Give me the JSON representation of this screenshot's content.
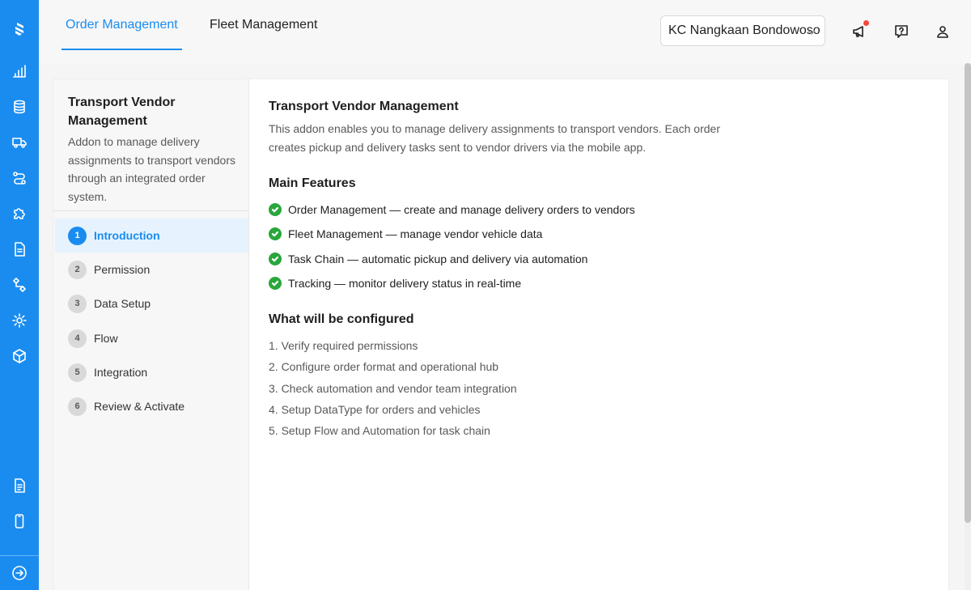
{
  "colors": {
    "brand": "#1a8cf0",
    "success": "#2aa63d",
    "notification": "#f5483b"
  },
  "rail": {
    "icons": [
      "logo-icon",
      "bar-chart-icon",
      "database-icon",
      "truck-icon",
      "route-icon",
      "puzzle-icon",
      "document-icon",
      "flow-icon",
      "gear-icon",
      "box-icon",
      "file-text-icon",
      "mobile-icon",
      "expand-icon"
    ]
  },
  "header": {
    "tabs": [
      {
        "label": "Order Management",
        "active": true
      },
      {
        "label": "Fleet Management",
        "active": false
      }
    ],
    "hub_select": {
      "value": "KC Nangkaan Bondowoso"
    },
    "icons": [
      "megaphone-icon",
      "help-icon",
      "user-icon"
    ]
  },
  "sidebar": {
    "title": "Transport Vendor Management",
    "description": "Addon to manage delivery assignments to transport vendors through an integrated order system.",
    "steps": [
      {
        "num": "1",
        "label": "Introduction",
        "active": true
      },
      {
        "num": "2",
        "label": "Permission",
        "active": false
      },
      {
        "num": "3",
        "label": "Data Setup",
        "active": false
      },
      {
        "num": "4",
        "label": "Flow",
        "active": false
      },
      {
        "num": "5",
        "label": "Integration",
        "active": false
      },
      {
        "num": "6",
        "label": "Review & Activate",
        "active": false
      }
    ]
  },
  "content": {
    "title": "Transport Vendor Management",
    "intro": "This addon enables you to manage delivery assignments to transport vendors. Each order creates pickup and delivery tasks sent to vendor drivers via the mobile app.",
    "features_heading": "Main Features",
    "features": [
      "Order Management — create and manage delivery orders to vendors",
      "Fleet Management — manage vendor vehicle data",
      "Task Chain — automatic pickup and delivery via automation",
      "Tracking — monitor delivery status in real-time"
    ],
    "config_heading": "What will be configured",
    "config_items": [
      "1. Verify required permissions",
      "2. Configure order format and operational hub",
      "3. Check automation and vendor team integration",
      "4. Setup DataType for orders and vehicles",
      "5. Setup Flow and Automation for task chain"
    ]
  }
}
